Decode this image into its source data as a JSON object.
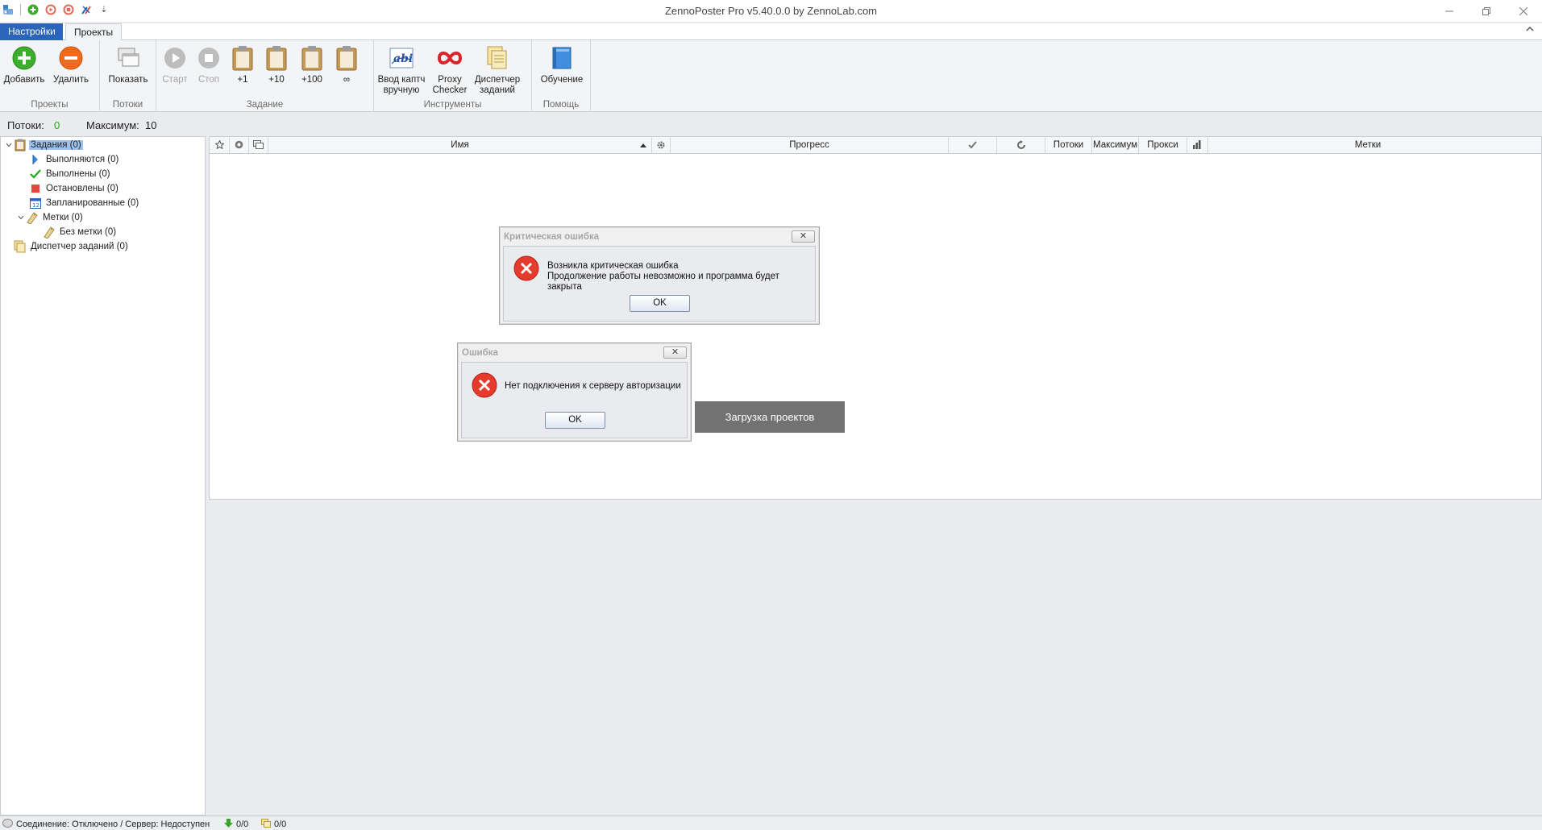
{
  "window": {
    "title": "ZennoPoster Pro v5.40.0.0 by ZennoLab.com",
    "qat_more": "⇣"
  },
  "tabs": {
    "settings": "Настройки",
    "projects": "Проекты"
  },
  "ribbon": {
    "groups": {
      "projects": {
        "label": "Проекты",
        "add": "Добавить",
        "delete": "Удалить"
      },
      "threads": {
        "label": "Потоки",
        "show": "Показать"
      },
      "task": {
        "label": "Задание",
        "start": "Старт",
        "stop": "Стоп",
        "plus1": "+1",
        "plus10": "+10",
        "plus100": "+100",
        "infinity": "∞"
      },
      "tools": {
        "label": "Инструменты",
        "captcha_line1": "Ввод каптч",
        "captcha_line2": "вручную",
        "proxy_line1": "Proxy",
        "proxy_line2": "Checker",
        "dispatcher_line1": "Диспетчер",
        "dispatcher_line2": "заданий"
      },
      "help": {
        "label": "Помощь",
        "training": "Обучение"
      }
    }
  },
  "threads_bar": {
    "threads_label": "Потоки:",
    "threads_value": "0",
    "max_label": "Максимум:",
    "max_value": "10"
  },
  "tree": {
    "tasks": "Задания (0)",
    "running": "Выполняются (0)",
    "done": "Выполнены (0)",
    "stopped": "Остановлены (0)",
    "scheduled": "Запланированные (0)",
    "tags": "Метки (0)",
    "no_tag": "Без метки (0)",
    "dispatcher": "Диспетчер заданий (0)"
  },
  "grid": {
    "columns": {
      "name": "Имя",
      "progress": "Прогресс",
      "threads": "Потоки",
      "max": "Максимум",
      "proxy": "Прокси",
      "tags": "Метки"
    }
  },
  "loading": {
    "text": "Загрузка проектов"
  },
  "critical_dialog": {
    "title": "Критическая ошибка",
    "line1": "Возникла критическая ошибка",
    "line2": "Продолжение работы невозможно и программа будет закрыта",
    "ok": "OK"
  },
  "error_dialog": {
    "title": "Ошибка",
    "message": "Нет подключения к серверу авторизации",
    "ok": "OK"
  },
  "status": {
    "connection": "Соединение: Отключено / Сервер: Недоступен",
    "downloads": "0/0",
    "tasks": "0/0"
  },
  "colors": {
    "accent": "#2b65b9",
    "selection": "#9cc3ee",
    "error_red": "#e53a2c",
    "green": "#2aa51d",
    "loading_bg": "#727272"
  }
}
